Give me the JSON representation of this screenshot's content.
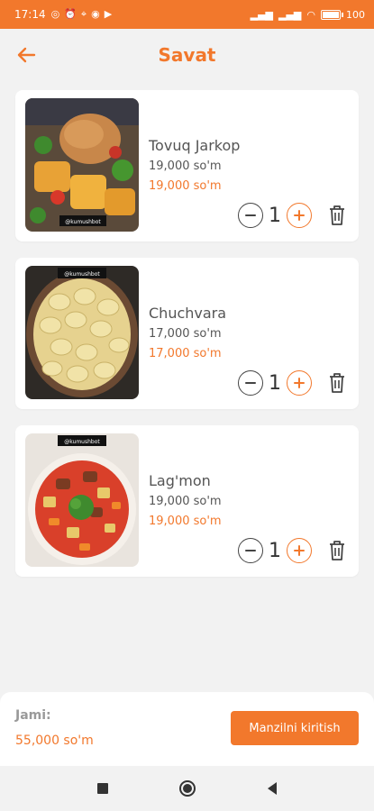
{
  "status": {
    "time": "17:14",
    "battery": "100",
    "left_icons": [
      "whatsapp-icon",
      "alarm-icon",
      "location-icon",
      "instagram-icon",
      "youtube-icon"
    ],
    "right_icons": [
      "signal-icon",
      "signal-icon",
      "wifi-icon",
      "battery-icon"
    ]
  },
  "header": {
    "title": "Savat",
    "back_icon": "arrow-left-icon"
  },
  "cart": {
    "items": [
      {
        "name": "Tovuq Jarkop",
        "price": "19,000 so'm",
        "total": "19,000 so'm",
        "quantity": "1",
        "image": "chicken-jarkop-photo",
        "image_tag": "@kumushbot"
      },
      {
        "name": "Chuchvara",
        "price": "17,000 so'm",
        "total": "17,000 so'm",
        "quantity": "1",
        "image": "chuchvara-dumplings-photo",
        "image_tag": "@kumushbot"
      },
      {
        "name": "Lag'mon",
        "price": "19,000 so'm",
        "total": "19,000 so'm",
        "quantity": "1",
        "image": "lagmon-soup-photo",
        "image_tag": "@kumushbot"
      }
    ]
  },
  "footer": {
    "total_label": "Jami:",
    "total_value": "55,000 so'm",
    "checkout_label": "Manzilni kiritish"
  },
  "colors": {
    "accent": "#f2782c",
    "background": "#f2f2f2",
    "card": "#ffffff",
    "text": "#555555"
  },
  "nav": {
    "icons": [
      "square-icon",
      "circle-icon",
      "triangle-back-icon"
    ]
  }
}
